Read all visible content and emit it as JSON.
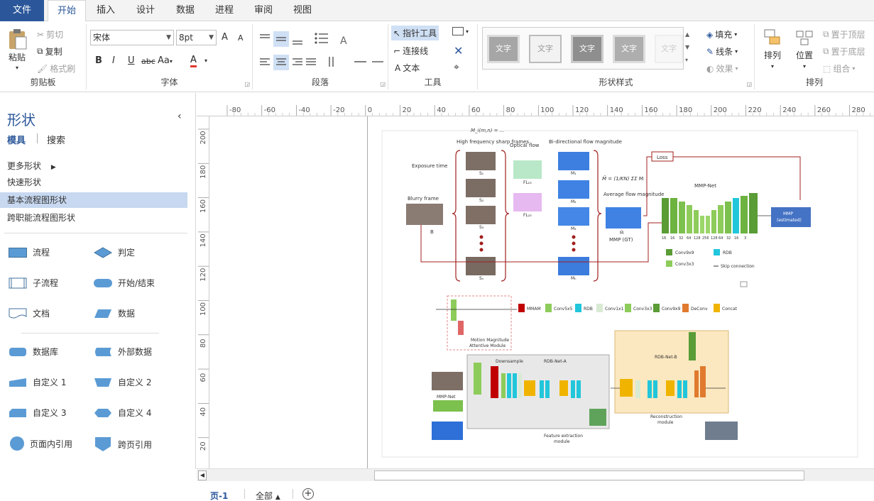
{
  "tabs": [
    {
      "label": "文件"
    },
    {
      "label": "开始"
    },
    {
      "label": "插入"
    },
    {
      "label": "设计"
    },
    {
      "label": "数据"
    },
    {
      "label": "进程"
    },
    {
      "label": "审阅"
    },
    {
      "label": "视图"
    }
  ],
  "clipboard": {
    "paste": "粘贴",
    "cut": "剪切",
    "copy": "复制",
    "format": "格式刷",
    "label": "剪贴板"
  },
  "font": {
    "name": "宋体",
    "size": "8pt",
    "bold": "B",
    "italic": "I",
    "underline": "U",
    "strike": "abc",
    "case": "Aa",
    "color": "A",
    "grow": "A",
    "shrink": "A",
    "label": "字体"
  },
  "paragraph": {
    "label": "段落"
  },
  "tools": {
    "pointer": "指针工具",
    "connector": "连接线",
    "text": "文本",
    "label": "工具"
  },
  "styles": {
    "swatches": [
      "文字",
      "文字",
      "文字",
      "文字",
      "文字"
    ],
    "fill": "填充",
    "line": "线条",
    "effect": "效果",
    "label": "形状样式"
  },
  "arrange": {
    "arrange": "排列",
    "position": "位置",
    "front": "置于顶层",
    "back": "置于底层",
    "group": "组合",
    "label": "排列"
  },
  "shapes_panel": {
    "title": "形状",
    "tab_stencils": "模具",
    "tab_search": "搜索",
    "more": "更多形状",
    "libs": [
      "快速形状",
      "基本流程图形状",
      "跨职能流程图形状"
    ],
    "items": [
      {
        "label": "流程"
      },
      {
        "label": "判定"
      },
      {
        "label": "子流程"
      },
      {
        "label": "开始/结束"
      },
      {
        "label": "文档"
      },
      {
        "label": "数据"
      },
      {
        "label": "数据库"
      },
      {
        "label": "外部数据"
      },
      {
        "label": "自定义 1"
      },
      {
        "label": "自定义 2"
      },
      {
        "label": "自定义 3"
      },
      {
        "label": "自定义 4"
      },
      {
        "label": "页面内引用"
      },
      {
        "label": "跨页引用"
      }
    ]
  },
  "ruler": {
    "top": [
      "-80",
      "-60",
      "-40",
      "-20",
      "0",
      "20",
      "40",
      "60",
      "80",
      "100",
      "120",
      "140",
      "160",
      "180",
      "200",
      "220",
      "240",
      "260",
      "280"
    ],
    "left": [
      "200",
      "180",
      "160",
      "140",
      "120",
      "100",
      "80",
      "60",
      "40",
      "20"
    ]
  },
  "status": {
    "page": "页-1",
    "all": "全部"
  },
  "figure": {
    "formula": "M_i(m,n) = ...",
    "exposure": "Exposure time",
    "high_freq": "High frequency sharp frames",
    "optical_flow": "Optical flow",
    "bidir": "Bi-directional flow magnitude",
    "blurry": "Blurry frame",
    "B": "B",
    "S_labels": [
      "S₁",
      "S₂",
      "S₃",
      "Sₙ"
    ],
    "FL_labels": [
      "FL₂₃",
      "FL₂₃"
    ],
    "M_labels": [
      "M₁",
      "M₂",
      "M₃",
      "Mₙ"
    ],
    "avg_flow": "Average flow magnitude",
    "mbar": "M̄",
    "mmp_gt": "MMP (GT)",
    "loss": "Loss",
    "mmp_net": "MMP-Net",
    "mmp_est": [
      "MMP",
      "(estimated)"
    ],
    "channels": [
      "16",
      "16",
      "32",
      "64",
      "128",
      "256",
      "128",
      "64",
      "32",
      "16",
      "3"
    ],
    "legend_a": [
      "Conv9x9",
      "Conv3x3"
    ],
    "legend_b": [
      "RDB",
      "Skip connection"
    ],
    "bottom_legend": [
      "MMAM",
      "Conv5x5",
      "RDB",
      "Conv1x1",
      "Conv3x3",
      "Conv9x9",
      "DeConv",
      "Concat"
    ],
    "mmam": [
      "Motion Magnitude",
      "Attentive Module"
    ],
    "downsample": "Downsample",
    "rdb_a": "RDB-Net-A",
    "rdb_b": "RDB-Net-B",
    "mmp_net2": "MMP-Net",
    "feat": [
      "Feature extraction",
      "module"
    ],
    "recon": [
      "Reconstruction",
      "module"
    ]
  }
}
